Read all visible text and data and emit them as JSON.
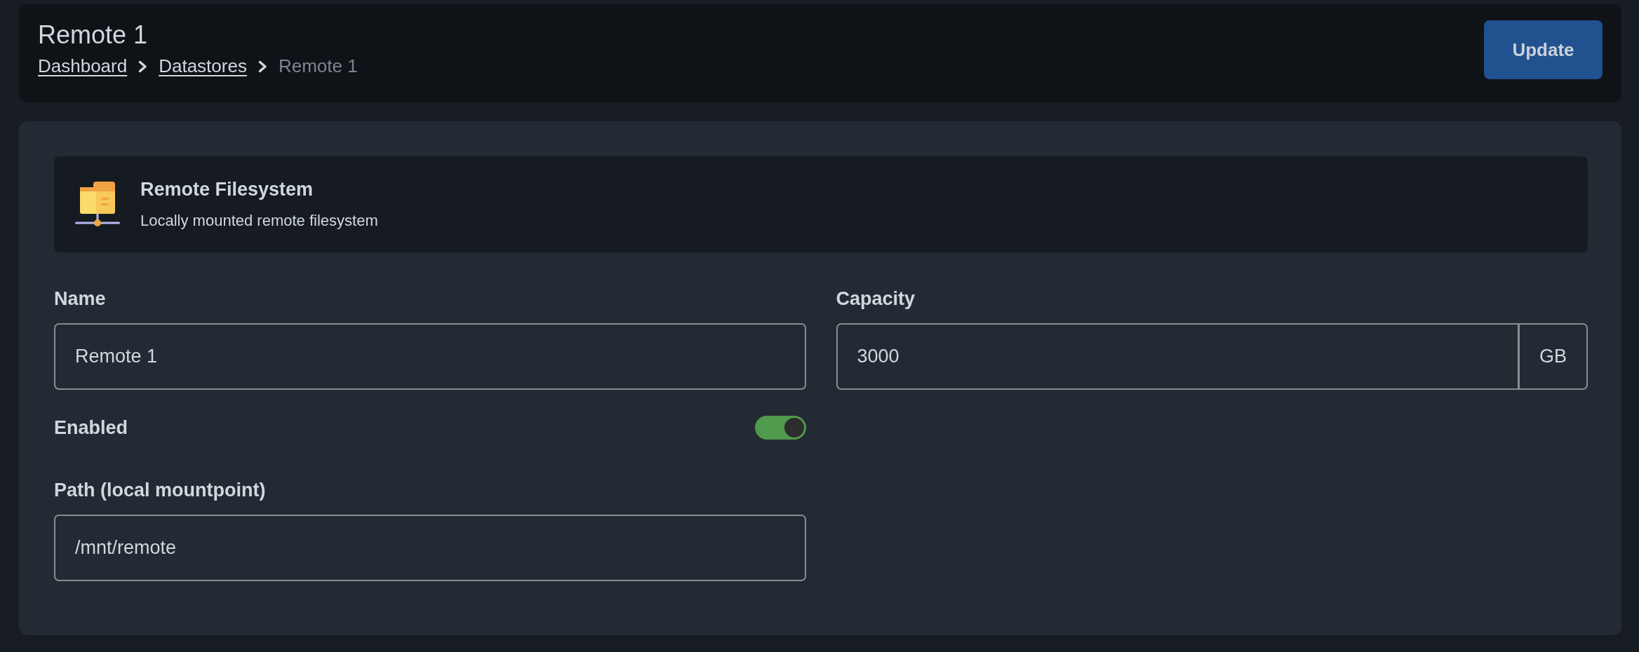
{
  "header": {
    "title": "Remote 1",
    "breadcrumb": [
      {
        "label": "Dashboard",
        "kind": "link"
      },
      {
        "label": "Datastores",
        "kind": "link"
      },
      {
        "label": "Remote 1",
        "kind": "current"
      }
    ],
    "update_button": "Update"
  },
  "datastore_type": {
    "title": "Remote Filesystem",
    "description": "Locally mounted remote filesystem"
  },
  "form": {
    "name": {
      "label": "Name",
      "value": "Remote 1"
    },
    "capacity": {
      "label": "Capacity",
      "value": "3000",
      "unit": "GB"
    },
    "enabled": {
      "label": "Enabled",
      "on": true
    },
    "path": {
      "label": "Path (local mountpoint)",
      "value": "/mnt/remote"
    }
  }
}
